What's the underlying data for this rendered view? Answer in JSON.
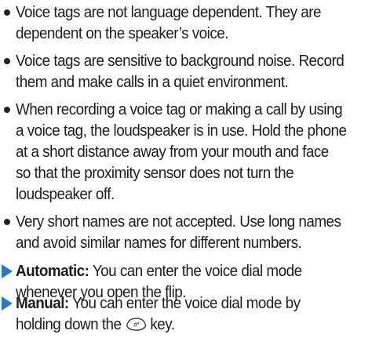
{
  "bullets": [
    {
      "lines": [
        "Voice tags are not language dependent. They are",
        "dependent on the speaker’s voice."
      ]
    },
    {
      "lines": [
        "Voice tags are sensitive to background noise. Record",
        "them and make calls in a quiet environment."
      ]
    },
    {
      "lines": [
        "When recording a voice tag or making a call by using",
        "a voice tag, the loudspeaker is in use. Hold the phone",
        "at a short distance away from your mouth and face",
        "so that the proximity sensor does not turn the",
        "loudspeaker off."
      ]
    },
    {
      "lines": [
        "Very short names are not accepted. Use long names",
        "and avoid similar names for different numbers."
      ]
    }
  ],
  "options": [
    {
      "label": "Automatic:",
      "line1": " You can enter the voice dial mode",
      "line2": "whenever you open the flip."
    },
    {
      "label": "Manual:",
      "line1": " You can enter the voice dial mode by",
      "line2_before": "holding down the",
      "line2_after": "key.",
      "key_icon": "hash-key-icon",
      "key_label": "#*"
    }
  ],
  "colors": {
    "text": "#1c1c1c",
    "arrow": "#2a78c2"
  }
}
